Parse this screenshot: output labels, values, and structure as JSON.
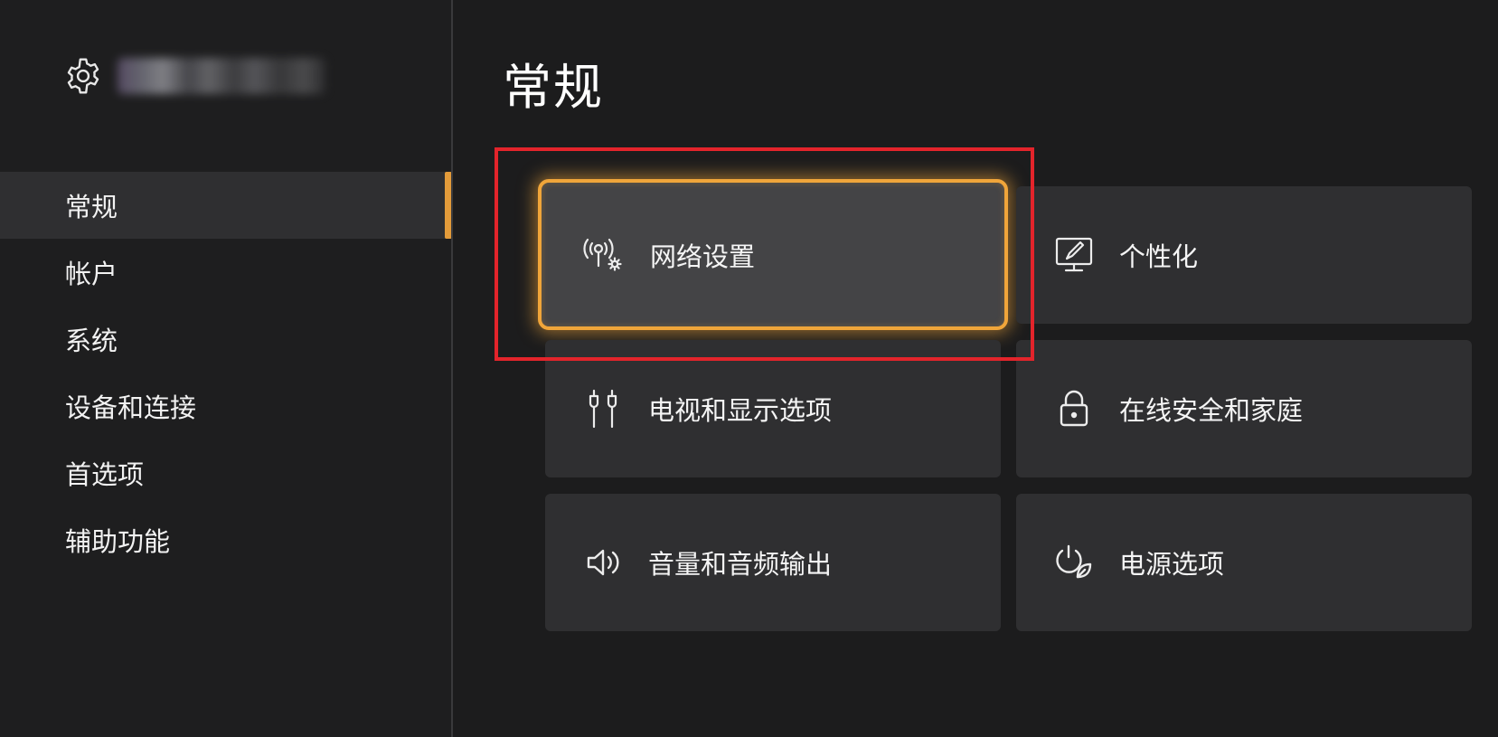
{
  "page": {
    "title": "常规"
  },
  "header": {
    "settings_icon": "gear-icon"
  },
  "sidebar": {
    "items": [
      {
        "label": "常规",
        "active": true
      },
      {
        "label": "帐户",
        "active": false
      },
      {
        "label": "系统",
        "active": false
      },
      {
        "label": "设备和连接",
        "active": false
      },
      {
        "label": "首选项",
        "active": false
      },
      {
        "label": "辅助功能",
        "active": false
      }
    ]
  },
  "tiles": [
    {
      "label": "网络设置",
      "icon": "network-settings-icon",
      "focused": true
    },
    {
      "label": "个性化",
      "icon": "personalization-icon",
      "focused": false
    },
    {
      "label": "电视和显示选项",
      "icon": "tv-cable-icon",
      "focused": false
    },
    {
      "label": "在线安全和家庭",
      "icon": "lock-icon",
      "focused": false
    },
    {
      "label": "音量和音频输出",
      "icon": "speaker-icon",
      "focused": false
    },
    {
      "label": "电源选项",
      "icon": "power-leaf-icon",
      "focused": false
    }
  ],
  "colors": {
    "background": "#1c1c1d",
    "tile": "#2f2f31",
    "focus_glow": "#f0a53a",
    "active_bar": "#e39b3a",
    "annotation_box": "#e3242b"
  }
}
